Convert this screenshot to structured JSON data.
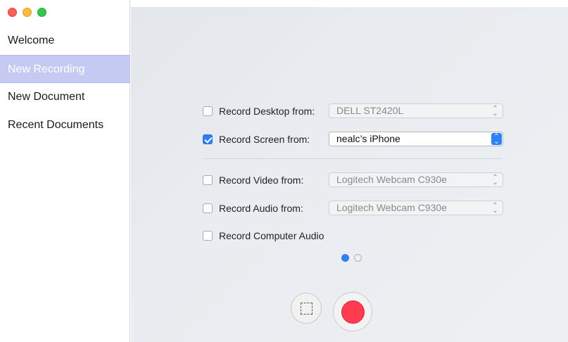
{
  "sidebar": {
    "items": [
      {
        "label": "Welcome",
        "selected": false
      },
      {
        "label": "New Recording",
        "selected": true
      },
      {
        "label": "New Document",
        "selected": false
      },
      {
        "label": "Recent Documents",
        "selected": false
      }
    ]
  },
  "options": {
    "desktop": {
      "label": "Record Desktop from:",
      "checked": false,
      "value": "DELL ST2420L"
    },
    "screen": {
      "label": "Record Screen from:",
      "checked": true,
      "value": "nealc’s iPhone"
    },
    "video": {
      "label": "Record Video from:",
      "checked": false,
      "value": "Logitech Webcam C930e"
    },
    "audio": {
      "label": "Record Audio from:",
      "checked": false,
      "value": "Logitech Webcam C930e"
    },
    "computer_audio": {
      "label": "Record Computer Audio",
      "checked": false
    }
  },
  "pager": {
    "current_page": 1,
    "total_pages": 2
  },
  "icons": {
    "area_button": "area-selection-icon",
    "record_button": "record-icon",
    "select_arrow": "chevron-updown-icon"
  },
  "colors": {
    "accent": "#2f7ff5",
    "selected_sidebar": "#c5caf3",
    "record_red": "#ff3b50",
    "close": "#fc605c",
    "minimize": "#fdbc40",
    "maximize": "#34c84a"
  }
}
